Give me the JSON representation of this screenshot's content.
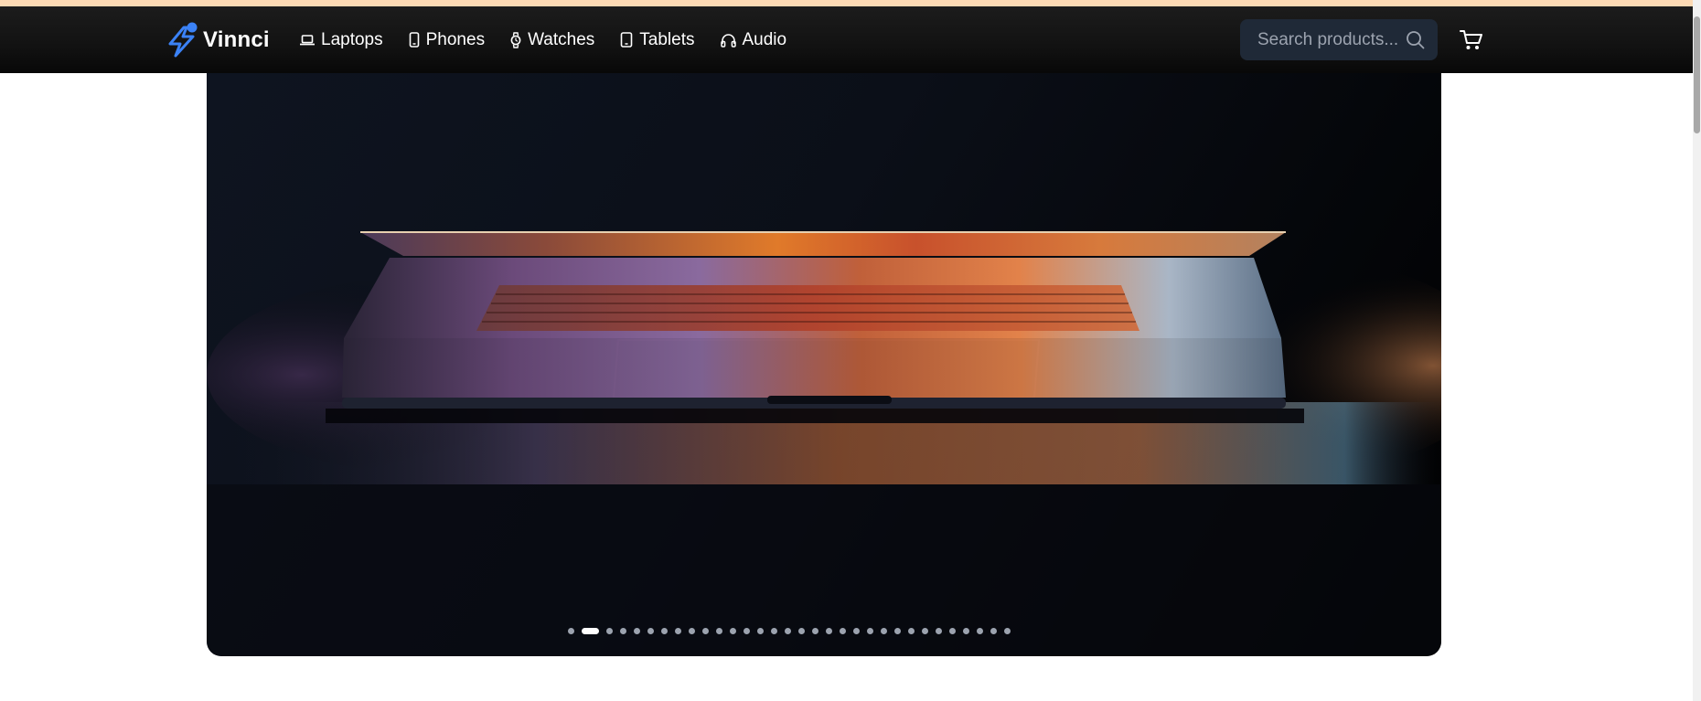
{
  "brand": {
    "name": "Vinnci",
    "color": "#3b82f6"
  },
  "nav": {
    "items": [
      {
        "label": "Laptops",
        "icon": "laptop-icon"
      },
      {
        "label": "Phones",
        "icon": "phone-icon"
      },
      {
        "label": "Watches",
        "icon": "watch-icon"
      },
      {
        "label": "Tablets",
        "icon": "tablet-icon"
      },
      {
        "label": "Audio",
        "icon": "headphones-icon"
      }
    ]
  },
  "search": {
    "placeholder": "Search products...",
    "value": ""
  },
  "cart": {
    "icon": "cart-icon"
  },
  "carousel": {
    "slide_count": 32,
    "active_index": 1,
    "image": "laptop-hero-image"
  },
  "colors": {
    "top_strip": "#fcd9b4",
    "navbar": "#121212",
    "search_bg": "#1f2937",
    "accent": "#3b82f6"
  }
}
